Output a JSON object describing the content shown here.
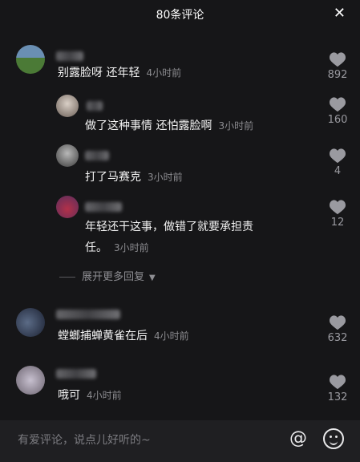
{
  "header": {
    "title": "80条评论",
    "close": "✕"
  },
  "comments": [
    {
      "text": "别露脸呀 还年轻",
      "time": "4小时前",
      "likes": "892"
    },
    {
      "text": "做了这种事情 还怕露脸啊",
      "time": "3小时前",
      "likes": "160"
    },
    {
      "text": "打了马赛克",
      "time": "3小时前",
      "likes": "4"
    },
    {
      "text_line1": "年轻还干这事，做错了就要承担责",
      "text_line2": "任。",
      "time": "3小时前",
      "likes": "12"
    },
    {
      "text": "螳螂捕蝉黄雀在后",
      "time": "4小时前",
      "likes": "632"
    },
    {
      "text": "哦可",
      "time": "4小时前",
      "likes": "132"
    }
  ],
  "expand_more": "展开更多回复",
  "input": {
    "placeholder": "有爱评论，说点儿好听的~"
  },
  "icons": {
    "at": "@",
    "emoji": "emoji-icon",
    "heart": "heart-icon"
  }
}
